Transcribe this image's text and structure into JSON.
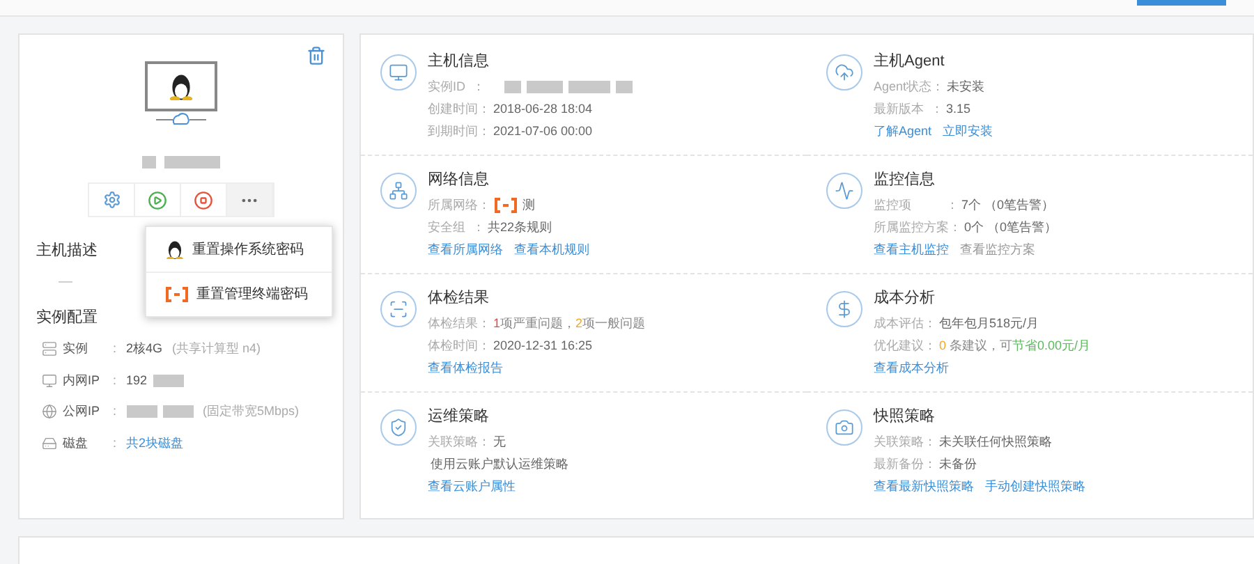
{
  "instance_card": {
    "actions": [
      {
        "kind": "settings"
      },
      {
        "kind": "start"
      },
      {
        "kind": "stop"
      },
      {
        "kind": "more",
        "expanded": true
      }
    ],
    "menu": [
      {
        "kind": "os",
        "label": "重置操作系统密码"
      },
      {
        "kind": "terminal",
        "label": "重置管理终端密码"
      }
    ],
    "description_title": "主机描述",
    "description": "—",
    "config_title": "实例配置",
    "config": [
      {
        "kind": "instance",
        "label": "实例",
        "colon": ":",
        "value": "2核4G",
        "suffix": "(共享计算型 n4)"
      },
      {
        "kind": "private_ip",
        "label": "内网IP",
        "colon": ":",
        "value": "192",
        "redacted": true
      },
      {
        "kind": "public_ip",
        "label": "公网IP",
        "colon": ":",
        "redacted": true,
        "suffix": "(固定带宽5Mbps)"
      },
      {
        "kind": "disk",
        "label": "磁盘",
        "colon": ":",
        "link": "共2块磁盘"
      }
    ]
  },
  "sections": [
    {
      "kind": "host",
      "title": "主机信息",
      "rows": [
        {
          "label": "实例ID  ：",
          "redacted": true
        },
        {
          "label": "创建时间：",
          "value": "2018-06-28 18:04"
        },
        {
          "label": "到期时间：",
          "value": "2021-07-06 00:00"
        }
      ]
    },
    {
      "kind": "agent",
      "title": "主机Agent",
      "rows": [
        {
          "label": "Agent状态：",
          "value": "未安装"
        },
        {
          "label": "最新版本  ：",
          "value": "3.15"
        }
      ],
      "links": [
        {
          "text": "了解Agent",
          "disabled": false
        },
        {
          "text": "立即安装",
          "disabled": false
        }
      ]
    },
    {
      "kind": "network",
      "title": "网络信息",
      "rows": [
        {
          "label": "所属网络：",
          "logo": true,
          "value": "测"
        },
        {
          "label": "安全组  ：",
          "value": "共22条规则"
        }
      ],
      "links": [
        {
          "text": "查看所属网络",
          "disabled": false
        },
        {
          "text": "查看本机规则",
          "disabled": false
        }
      ]
    },
    {
      "kind": "monitor",
      "title": "监控信息",
      "rows": [
        {
          "label": "监控项          ：",
          "value": "7个 （0笔告警）"
        },
        {
          "label": "所属监控方案：",
          "value": "0个 （0笔告警）"
        }
      ],
      "links": [
        {
          "text": "查看主机监控",
          "disabled": false
        },
        {
          "text": "查看监控方案",
          "disabled": true
        }
      ]
    },
    {
      "kind": "checkup",
      "title": "体检结果",
      "rows": [
        {
          "label": "体检结果：",
          "parts": [
            {
              "text": "1",
              "color": "#e5484d"
            },
            {
              "text": "项严重问题，",
              "color": "#888888"
            },
            {
              "text": "2",
              "color": "#f5a623"
            },
            {
              "text": "项一般问题",
              "color": "#888888"
            }
          ]
        },
        {
          "label": "体检时间：",
          "value": "2020-12-31 16:25"
        }
      ],
      "links": [
        {
          "text": "查看体检报告",
          "disabled": false
        }
      ]
    },
    {
      "kind": "cost",
      "title": "成本分析",
      "rows": [
        {
          "label": "成本评估：",
          "value": "包年包月518元/月"
        },
        {
          "label": "优化建议：",
          "parts": [
            {
              "text": "0",
              "color": "#f5a623"
            },
            {
              "text": " 条建议，可",
              "color": "#888888"
            },
            {
              "text": "节省0.00元/月",
              "color": "#5cb85c"
            }
          ]
        }
      ],
      "links": [
        {
          "text": "查看成本分析",
          "disabled": false
        }
      ]
    },
    {
      "kind": "ops",
      "title": "运维策略",
      "rows": [
        {
          "label": "关联策略：",
          "value": "无"
        },
        {
          "value": "使用云账户默认运维策略"
        }
      ],
      "links": [
        {
          "text": "查看云账户属性",
          "disabled": false
        }
      ]
    },
    {
      "kind": "snapshot",
      "title": "快照策略",
      "rows": [
        {
          "label": "关联策略：",
          "value": "未关联任何快照策略"
        },
        {
          "label": "最新备份：",
          "value": "未备份"
        }
      ],
      "links": [
        {
          "text": "查看最新快照策略",
          "disabled": false
        },
        {
          "text": "手动创建快照策略",
          "disabled": false
        }
      ]
    }
  ]
}
